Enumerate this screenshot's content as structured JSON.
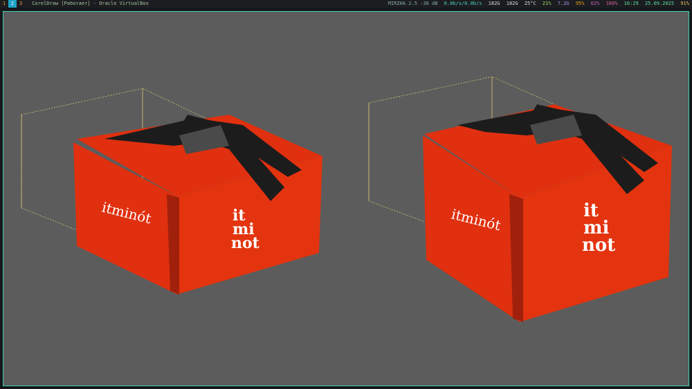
{
  "taskbar": {
    "workspaces": [
      {
        "label": "1",
        "active": false
      },
      {
        "label": "2",
        "active": true
      },
      {
        "label": "3",
        "active": false
      }
    ],
    "window_title": "CorelDraw [Работает] - Oracle VirtualBox",
    "status": {
      "wifi": "MIRZHA 2.5 -38 dB",
      "network": "0.0b/s/0.0b/s",
      "home": "182G",
      "disk": "182G",
      "temp": "25°C",
      "cpu": "21%",
      "memory": "7.2G",
      "brightness": "95%",
      "volume": "62%",
      "mic": "100%",
      "time": "16:29",
      "date": "25.09.2025",
      "battery": "91%"
    }
  },
  "canvas": {
    "brand_horizontal": "itminót",
    "brand_stacked": [
      "it",
      "mi",
      "not"
    ],
    "colors": {
      "bag": "#e0300f",
      "bag_dark": "#a0200c",
      "strap": "#1c1c1c",
      "handle": "#4a4a4a",
      "background": "#5c5c5c",
      "accent": "#3fd0b0"
    }
  }
}
